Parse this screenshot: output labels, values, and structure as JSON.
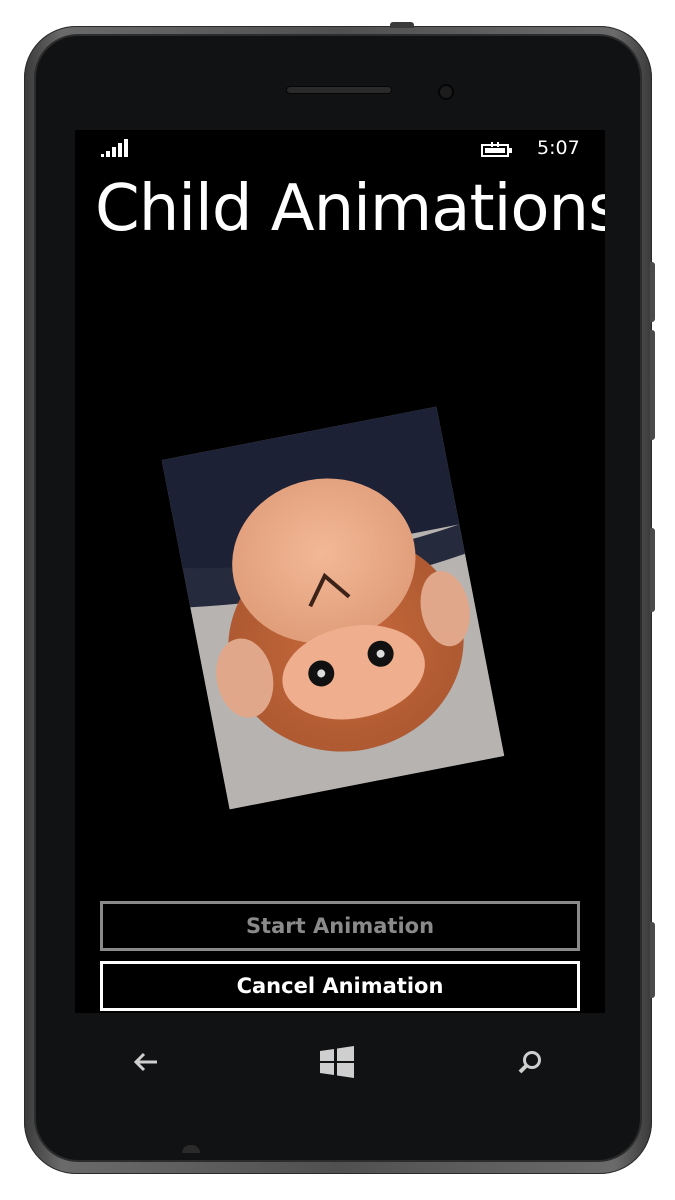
{
  "status_bar": {
    "time": "5:07",
    "signal_icon": "signal-strength-icon",
    "battery_icon": "battery-charging-icon"
  },
  "page": {
    "title": "Child Animations"
  },
  "image": {
    "description_icon": "rotated-photo-image"
  },
  "buttons": {
    "start_label": "Start Animation",
    "cancel_label": "Cancel Animation"
  },
  "nav": {
    "back_icon": "back-arrow-icon",
    "start_icon": "windows-logo-icon",
    "search_icon": "search-icon"
  },
  "colors": {
    "screen_bg": "#000000",
    "text": "#ffffff",
    "disabled": "#8a8a8a"
  }
}
